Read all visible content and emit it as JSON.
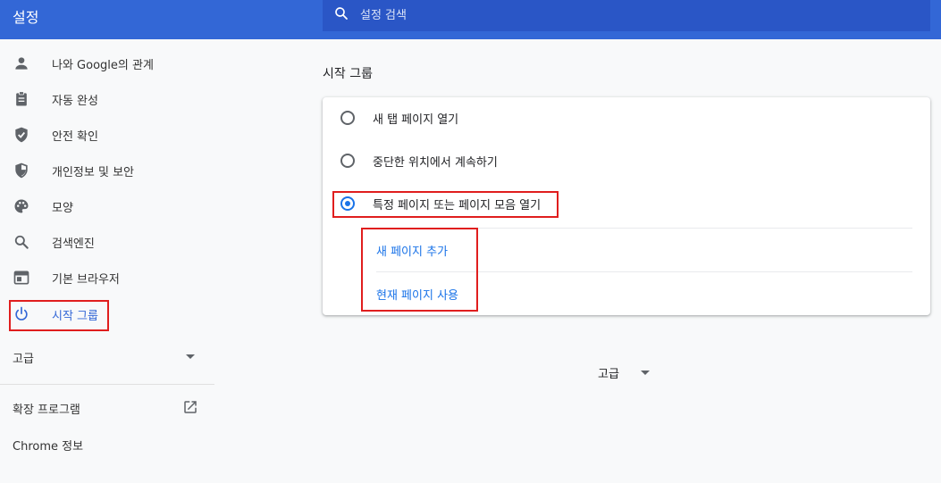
{
  "header": {
    "title": "설정",
    "search_placeholder": "설정 검색",
    "search_icon": "search-icon"
  },
  "sidebar": {
    "items": [
      {
        "label": "나와 Google의 관계",
        "icon": "person-icon"
      },
      {
        "label": "자동 완성",
        "icon": "clipboard-icon"
      },
      {
        "label": "안전 확인",
        "icon": "shield-check-icon"
      },
      {
        "label": "개인정보 및 보안",
        "icon": "shield-half-icon"
      },
      {
        "label": "모양",
        "icon": "palette-icon"
      },
      {
        "label": "검색엔진",
        "icon": "search-icon"
      },
      {
        "label": "기본 브라우저",
        "icon": "browser-icon"
      },
      {
        "label": "시작 그룹",
        "icon": "power-icon",
        "active": true
      }
    ],
    "advanced_label": "고급",
    "extensions_label": "확장 프로그램",
    "about_label": "Chrome 정보"
  },
  "main": {
    "section_title": "시작 그룹",
    "options": [
      {
        "label": "새 탭 페이지 열기",
        "checked": false
      },
      {
        "label": "중단한 위치에서 계속하기",
        "checked": false
      },
      {
        "label": "특정 페이지 또는 페이지 모음 열기",
        "checked": true
      }
    ],
    "links": {
      "add_page": "새 페이지 추가",
      "use_current": "현재 페이지 사용"
    },
    "advanced_label": "고급"
  },
  "colors": {
    "header": "#3367d6",
    "search_bg": "#2a56c6",
    "accent": "#1a73e8",
    "highlight": "#e01e1e"
  }
}
